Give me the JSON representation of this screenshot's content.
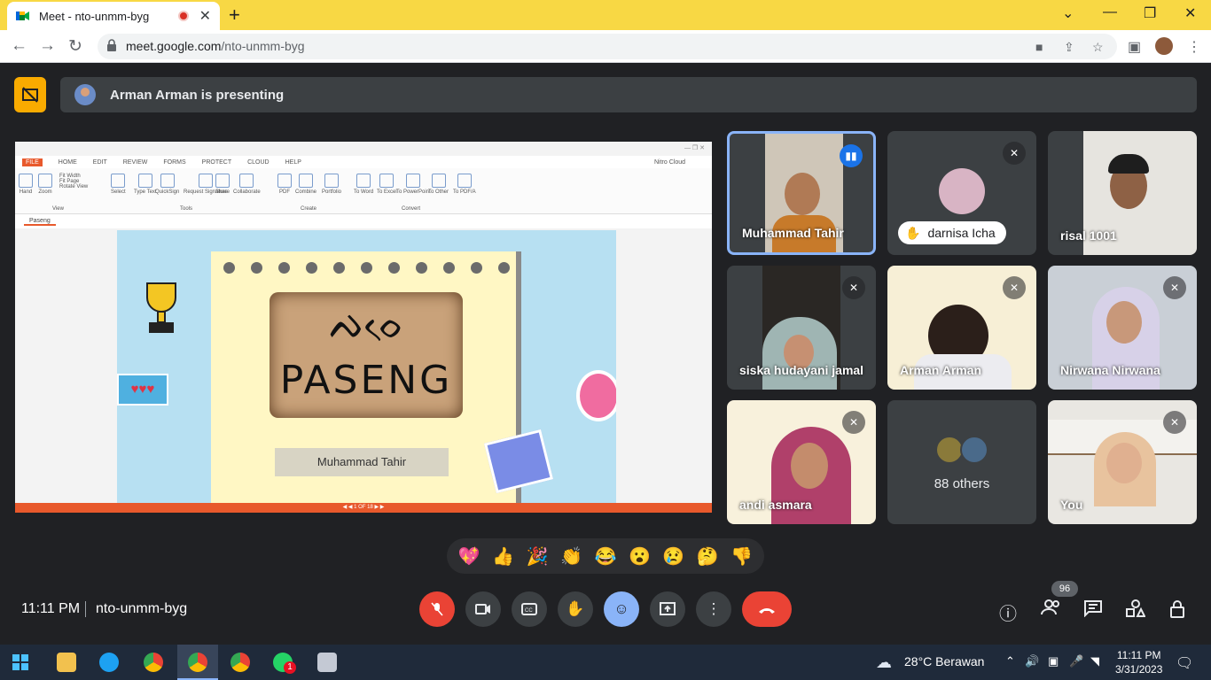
{
  "browser": {
    "tab_title": "Meet - nto-unmm-byg",
    "tab_close": "✕",
    "new_tab": "+",
    "url_host": "meet.google.com",
    "url_path": "/nto-unmm-byg",
    "colors": {
      "titlebar": "#f8d844"
    }
  },
  "banner": {
    "presenting_text": "Arman Arman is presenting"
  },
  "slide": {
    "app_menu": [
      "FILE",
      "HOME",
      "EDIT",
      "REVIEW",
      "FORMS",
      "PROTECT",
      "CLOUD",
      "HELP"
    ],
    "ribbon_buttons": [
      "Hand",
      "Zoom",
      "Fit Width",
      "Fit Page",
      "Rotate View",
      "Select",
      "Type Text",
      "QuickSign",
      "Request Signature",
      "Share",
      "Collaborate",
      "PDF",
      "Combine",
      "Portfolio",
      "To Word",
      "To Excel",
      "To PowerPoint",
      "To Other",
      "To PDF/A"
    ],
    "ribbon_groups": [
      "View",
      "Tools",
      "Create",
      "Convert"
    ],
    "cloud_label": "Nitro Cloud",
    "doc_tab": "Paseng",
    "script_text": "ᨄᨔᨙ",
    "title": "PASENG",
    "presenter_name": "Muhammad Tahir",
    "hearts": "♥♥♥"
  },
  "participants": [
    {
      "name": "Muhammad Tahir",
      "state": "speaking"
    },
    {
      "name": "darnisa Icha",
      "state": "muted"
    },
    {
      "name": "risal 1001",
      "state": ""
    },
    {
      "name": "siska hudayani jamal",
      "state": "muted"
    },
    {
      "name": "Arman Arman",
      "state": "muted"
    },
    {
      "name": "Nirwana Nirwana",
      "state": "muted"
    },
    {
      "name": "andi asmara",
      "state": "muted"
    },
    {
      "name": "88 others",
      "state": ""
    },
    {
      "name": "You",
      "state": "muted"
    }
  ],
  "reactions": [
    "💖",
    "👍",
    "🎉",
    "👏",
    "😂",
    "😮",
    "😢",
    "🤔",
    "👎"
  ],
  "controls": {
    "time": "11:11 PM",
    "meeting_code": "nto-unmm-byg",
    "participant_count": "96"
  },
  "taskbar": {
    "weather": "28°C  Berawan",
    "clock_time": "11:11 PM",
    "clock_date": "3/31/2023",
    "whatsapp_badge": "1"
  }
}
